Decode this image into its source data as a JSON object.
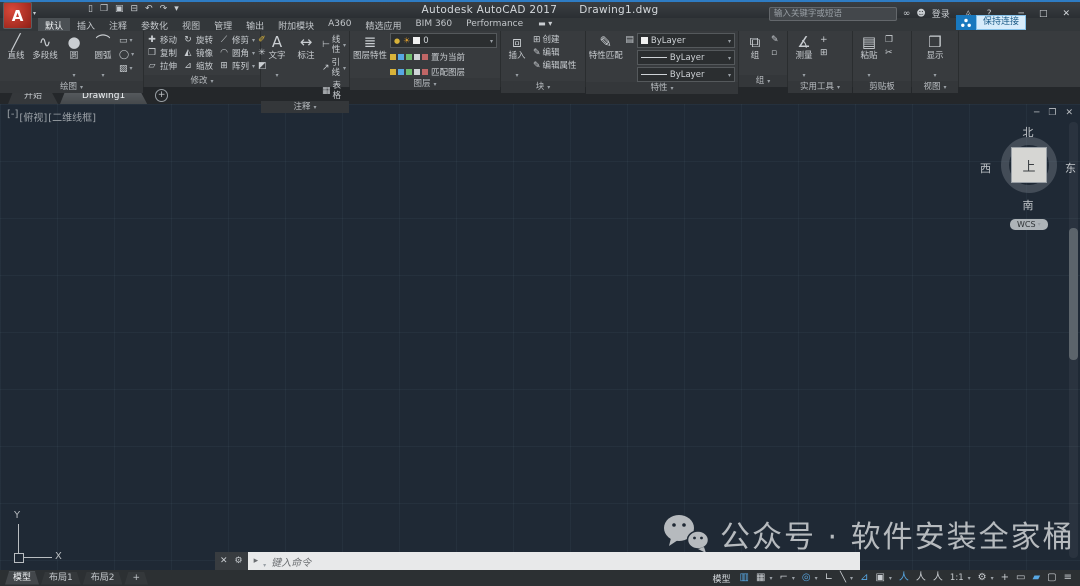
{
  "glyphs": {
    "caret_down": "▾"
  },
  "colors": {
    "accent_blue": "#57a7e3",
    "canvas_bg": "#1f2935",
    "ribbon_bg": "#383b3e",
    "popup_blue": "#1878be"
  },
  "titlebar": {
    "logo_letter": "A",
    "qat_icons": [
      {
        "name": "new-file-icon",
        "glyph": "▯"
      },
      {
        "name": "open-file-icon",
        "glyph": "❒"
      },
      {
        "name": "save-icon",
        "glyph": "▣"
      },
      {
        "name": "plot-icon",
        "glyph": "⊟"
      },
      {
        "name": "undo-icon",
        "glyph": "↶"
      },
      {
        "name": "redo-icon",
        "glyph": "↷"
      },
      {
        "name": "qat-menu-icon",
        "glyph": "▾"
      }
    ],
    "app_title": "Autodesk AutoCAD 2017",
    "doc_title": "Drawing1.dwg",
    "search_placeholder": "输入关键字或短语",
    "binoculars_icon": "∞",
    "person_icon": "☻",
    "sign_in": "登录",
    "a360_icon": "◬",
    "help_icon": "?",
    "win_min": "─",
    "win_max": "□",
    "win_close": "✕",
    "a360_popup": "保持连接"
  },
  "ribbon": {
    "tabs": [
      "默认",
      "插入",
      "注释",
      "参数化",
      "视图",
      "管理",
      "输出",
      "附加模块",
      "A360",
      "精选应用",
      "BIM 360",
      "Performance"
    ],
    "active_tab": "默认",
    "options_icon": "▬",
    "panels": {
      "draw": {
        "label": "绘图",
        "tools": [
          {
            "label": "直线",
            "glyph": "╱"
          },
          {
            "label": "多段线",
            "glyph": "∿"
          },
          {
            "label": "圆",
            "glyph": "●"
          },
          {
            "label": "圆弧",
            "glyph": "⌒"
          }
        ],
        "extra": [
          {
            "name": "rectangle-icon",
            "glyph": "▭"
          },
          {
            "name": "ellipse-icon",
            "glyph": "◯"
          },
          {
            "name": "hatch-icon",
            "glyph": "▨"
          }
        ]
      },
      "modify": {
        "label": "修改",
        "grid": [
          {
            "label": "移动",
            "glyph": "✚"
          },
          {
            "label": "旋转",
            "glyph": "↻"
          },
          {
            "label": "修剪",
            "glyph": "⟋"
          },
          {
            "label": "复制",
            "glyph": "❐"
          },
          {
            "label": "镜像",
            "glyph": "◭"
          },
          {
            "label": "圆角",
            "glyph": "◠"
          },
          {
            "label": "拉伸",
            "glyph": "▱"
          },
          {
            "label": "缩放",
            "glyph": "⊿"
          },
          {
            "label": "阵列",
            "glyph": "⊞"
          }
        ],
        "extra": [
          {
            "name": "erase-icon",
            "glyph": "✐"
          },
          {
            "name": "explode-icon",
            "glyph": "✳"
          },
          {
            "name": "join-icon",
            "glyph": "◩"
          }
        ]
      },
      "annotation": {
        "label": "注释",
        "big": [
          {
            "label": "文字",
            "glyph": "A"
          },
          {
            "label": "标注",
            "glyph": "↔"
          }
        ],
        "small": [
          {
            "label": "线性",
            "glyph": "⊢"
          },
          {
            "label": "引线",
            "glyph": "↗"
          },
          {
            "label": "表格",
            "glyph": "▦"
          }
        ]
      },
      "layers": {
        "label": "图层",
        "big_label": "图层特性",
        "big_glyph": "≣",
        "dropdown": {
          "bulb": "●",
          "sun": "☀",
          "value": "0"
        },
        "row_buttons": [
          "置为当前",
          "匹配图层"
        ],
        "state_colors": [
          "#d8b33a",
          "#57a7e3",
          "#6fbf6f",
          "#d0d4d8",
          "#c06666"
        ]
      },
      "block": {
        "label": "块",
        "big_label": "插入",
        "big_glyph": "⧈",
        "small": [
          {
            "label": "创建",
            "glyph": "⊞"
          },
          {
            "label": "编辑",
            "glyph": "✎"
          },
          {
            "label": "编辑属性",
            "glyph": "✎"
          }
        ]
      },
      "properties": {
        "label": "特性",
        "big_label": "特性匹配",
        "big_glyph": "✎",
        "list_icon": "▤",
        "dropdowns": [
          "ByLayer",
          "ByLayer",
          "ByLayer"
        ]
      },
      "groups": {
        "label": "组",
        "big_label": "组",
        "big_glyph": "⧉",
        "minis": [
          "✎",
          "▫"
        ]
      },
      "utilities": {
        "label": "实用工具",
        "big_label": "测量",
        "big_glyph": "∡",
        "minis": [
          "+",
          "⊞"
        ]
      },
      "clipboard": {
        "label": "剪贴板",
        "big_label": "粘贴",
        "big_glyph": "▤",
        "minis": [
          "❐",
          "✂"
        ]
      },
      "view": {
        "label": "视图",
        "big_label": "显示",
        "big_glyph": "❒"
      }
    }
  },
  "file_tabs": {
    "tabs": [
      {
        "label": "开始",
        "active": false
      },
      {
        "label": "Drawing1",
        "active": true
      }
    ],
    "new_tab": "+"
  },
  "canvas": {
    "viewport_controls": [
      "[-]",
      "[俯视]",
      "[二维线框]"
    ],
    "win_min": "─",
    "win_restore": "❐",
    "win_close": "✕",
    "viewcube": {
      "north": "北",
      "south": "南",
      "west": "西",
      "east": "东",
      "top": "上",
      "wcs": "WCS"
    },
    "ucs": {
      "x": "X",
      "y": "Y"
    },
    "watermark": "公众号 · 软件安装全家桶"
  },
  "command_line": {
    "close": "✕",
    "customize_icon": "⚙",
    "prompt_icon": "▸",
    "placeholder": "键入命令"
  },
  "statusbar": {
    "layout_tabs": [
      {
        "label": "模型",
        "active": true
      },
      {
        "label": "布局1",
        "active": false
      },
      {
        "label": "布局2",
        "active": false
      },
      {
        "label": "+",
        "active": false
      }
    ],
    "model_label": "模型",
    "icons": [
      {
        "name": "model-space-icon",
        "glyph": "▥",
        "active": true
      },
      {
        "name": "grid-icon",
        "glyph": "▦",
        "caret": true
      },
      {
        "name": "snap-icon",
        "glyph": "⌐",
        "caret": true
      },
      {
        "name": "polar-tracking-icon",
        "glyph": "◎",
        "active": true,
        "caret": true
      },
      {
        "name": "ortho-icon",
        "glyph": "∟"
      },
      {
        "name": "osnap-tracking-icon",
        "glyph": "╲",
        "caret": true
      },
      {
        "name": "dynamic-input-icon",
        "glyph": "⊿",
        "active": true
      },
      {
        "name": "osnap-icon",
        "glyph": "▣",
        "caret": true
      },
      {
        "name": "annotation-visibility-icon",
        "glyph": "人",
        "active": true
      },
      {
        "name": "autoscale-icon",
        "glyph": "人"
      },
      {
        "name": "annotation-scale-icon",
        "glyph": "人"
      },
      {
        "name": "annotation-scale-value",
        "text": "1:1",
        "caret": true
      },
      {
        "name": "workspace-switch-icon",
        "glyph": "⚙",
        "caret": true
      },
      {
        "name": "annotation-monitor-icon",
        "glyph": "+"
      },
      {
        "name": "quick-properties-icon",
        "glyph": "▭"
      },
      {
        "name": "graphics-performance-icon",
        "glyph": "▰",
        "active": true
      },
      {
        "name": "clean-screen-icon",
        "glyph": "▢"
      },
      {
        "name": "customize-icon",
        "glyph": "≡"
      }
    ]
  }
}
